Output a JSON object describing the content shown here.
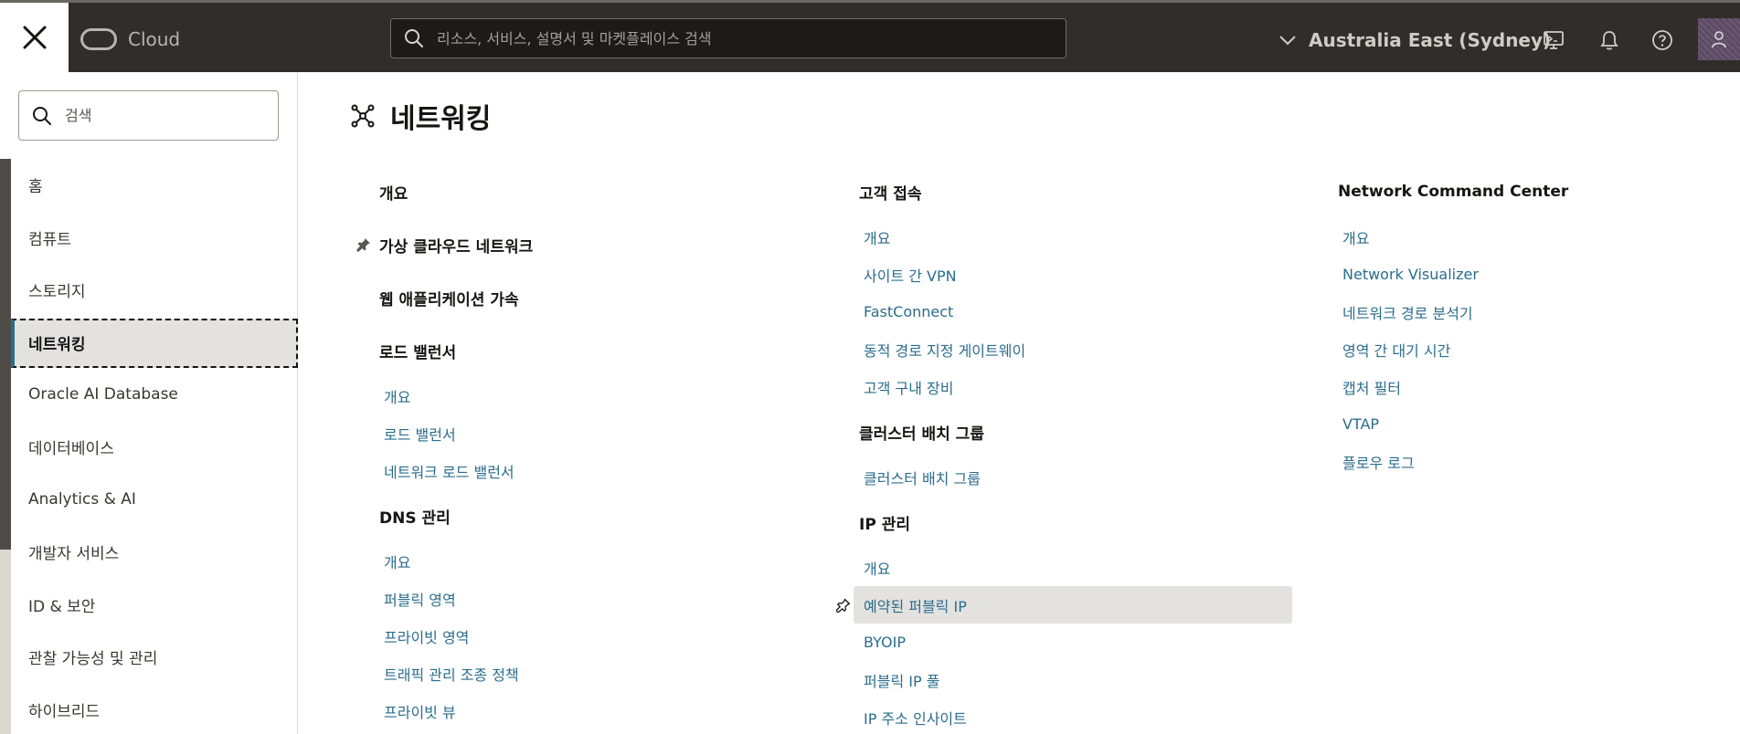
{
  "topbar": {
    "brand": "Cloud",
    "search_placeholder": "리소스, 서비스, 설명서 및 마켓플레이스 검색",
    "region": "Australia East (Sydney)"
  },
  "sidebar": {
    "search_placeholder": "검색",
    "items": [
      {
        "label": "홈"
      },
      {
        "label": "컴퓨트"
      },
      {
        "label": "스토리지"
      },
      {
        "label": "네트워킹"
      },
      {
        "label": "Oracle AI Database"
      },
      {
        "label": "데이터베이스"
      },
      {
        "label": "Analytics & AI"
      },
      {
        "label": "개발자 서비스"
      },
      {
        "label": "ID & 보안"
      },
      {
        "label": "관찰 가능성 및 관리"
      },
      {
        "label": "하이브리드"
      }
    ]
  },
  "main": {
    "title": "네트워킹",
    "col1": [
      {
        "label": "개요"
      },
      {
        "label": "가상 클라우드 네트워크"
      },
      {
        "label": "웹 애플리케이션 가속"
      },
      {
        "label": "로드 밸런서"
      },
      {
        "label": "개요"
      },
      {
        "label": "로드 밸런서"
      },
      {
        "label": "네트워크 로드 밸런서"
      },
      {
        "label": "DNS 관리"
      },
      {
        "label": "개요"
      },
      {
        "label": "퍼블릭 영역"
      },
      {
        "label": "프라이빗 영역"
      },
      {
        "label": "트래픽 관리 조종 정책"
      },
      {
        "label": "프라이빗 뷰"
      }
    ],
    "col2": [
      {
        "label": "고객 접속"
      },
      {
        "label": "개요"
      },
      {
        "label": "사이트 간 VPN"
      },
      {
        "label": "FastConnect"
      },
      {
        "label": "동적 경로 지정 게이트웨이"
      },
      {
        "label": "고객 구내 장비"
      },
      {
        "label": "클러스터 배치 그룹"
      },
      {
        "label": "클러스터 배치 그룹"
      },
      {
        "label": "IP 관리"
      },
      {
        "label": "개요"
      },
      {
        "label": "예약된 퍼블릭 IP"
      },
      {
        "label": "BYOIP"
      },
      {
        "label": "퍼블릭 IP 풀"
      },
      {
        "label": "IP 주소 인사이트"
      }
    ],
    "col3": [
      {
        "label": "Network Command Center"
      },
      {
        "label": "개요"
      },
      {
        "label": "Network Visualizer"
      },
      {
        "label": "네트워크 경로 분석기"
      },
      {
        "label": "영역 간 대기 시간"
      },
      {
        "label": "캡처 필터"
      },
      {
        "label": "VTAP"
      },
      {
        "label": "플로우 로그"
      }
    ]
  },
  "colors": {
    "topbar_bg": "#312d2a",
    "link": "#2b6d8c",
    "active_accent": "#2b6d8c",
    "highlight_bg": "#e4e2df"
  }
}
